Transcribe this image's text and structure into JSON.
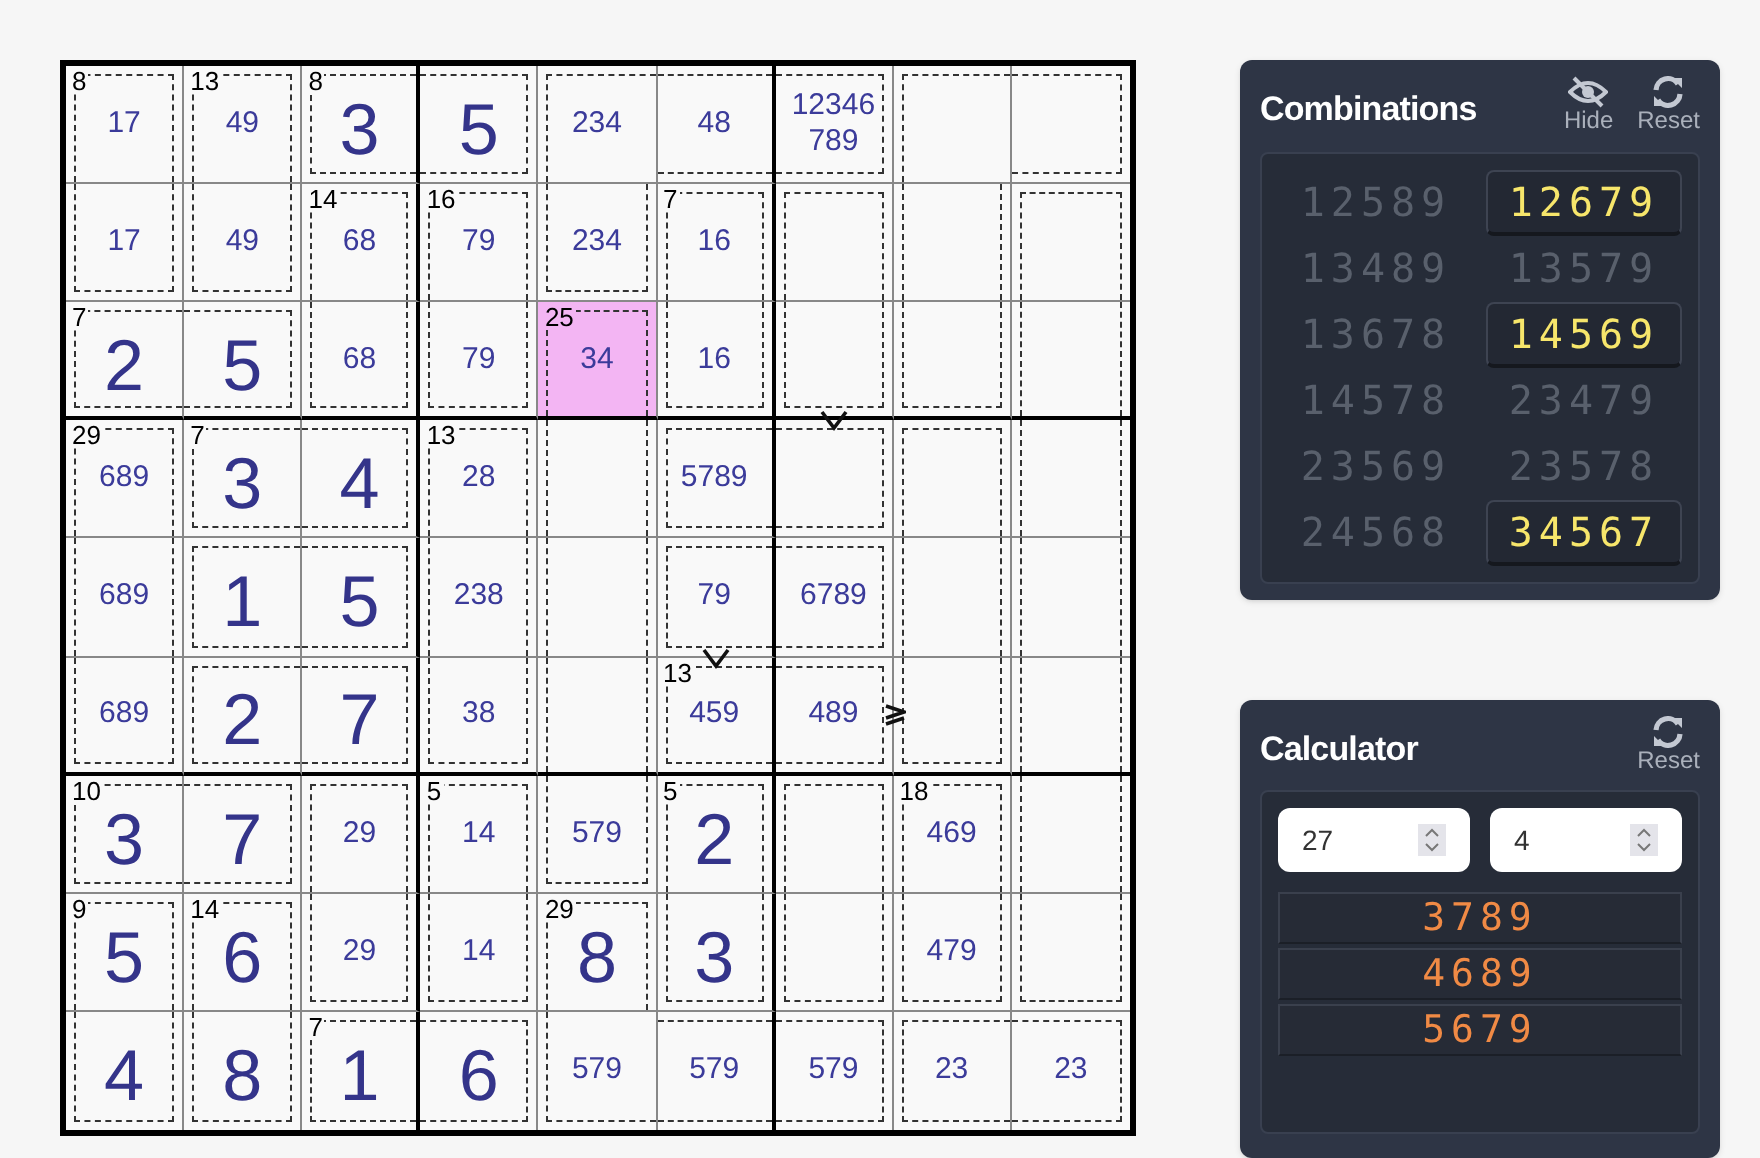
{
  "puzzle": {
    "rows": [
      [
        {
          "candidates": "17",
          "cage_sum": "8",
          "cage_top": true,
          "cage_right": true,
          "cage_bottom": false,
          "cage_left": true,
          "selected": false
        },
        {
          "candidates": "49",
          "cage_sum": "13",
          "cage_top": true,
          "cage_right": true,
          "cage_bottom": false,
          "cage_left": true,
          "selected": false
        },
        {
          "value": "3",
          "cage_sum": "8",
          "cage_top": true,
          "cage_right": false,
          "cage_bottom": true,
          "cage_left": true,
          "selected": false
        },
        {
          "value": "5",
          "cage_top": true,
          "cage_right": true,
          "cage_bottom": true,
          "cage_left": false,
          "selected": false
        },
        {
          "candidates": "234",
          "cage_top": true,
          "cage_right": false,
          "cage_bottom": false,
          "cage_left": true,
          "selected": false
        },
        {
          "candidates": "48",
          "cage_top": true,
          "cage_right": false,
          "cage_bottom": true,
          "cage_left": false,
          "selected": false
        },
        {
          "candidates": "12346789",
          "cage_top": true,
          "cage_right": true,
          "cage_bottom": true,
          "cage_left": false,
          "selected": false
        },
        {
          "cage_top": true,
          "cage_right": false,
          "cage_bottom": false,
          "cage_left": true,
          "selected": false
        },
        {
          "cage_top": true,
          "cage_right": true,
          "cage_bottom": true,
          "cage_left": false,
          "selected": false
        }
      ],
      [
        {
          "candidates": "17",
          "cage_top": false,
          "cage_right": true,
          "cage_bottom": true,
          "cage_left": true,
          "selected": false
        },
        {
          "candidates": "49",
          "cage_top": false,
          "cage_right": true,
          "cage_bottom": true,
          "cage_left": true,
          "selected": false
        },
        {
          "candidates": "68",
          "cage_sum": "14",
          "cage_top": true,
          "cage_right": true,
          "cage_bottom": false,
          "cage_left": true,
          "selected": false
        },
        {
          "candidates": "79",
          "cage_sum": "16",
          "cage_top": true,
          "cage_right": true,
          "cage_bottom": false,
          "cage_left": true,
          "selected": false
        },
        {
          "candidates": "234",
          "cage_top": false,
          "cage_right": true,
          "cage_bottom": true,
          "cage_left": true,
          "selected": false
        },
        {
          "candidates": "16",
          "cage_sum": "7",
          "cage_top": true,
          "cage_right": true,
          "cage_bottom": false,
          "cage_left": true,
          "selected": false
        },
        {
          "cage_top": true,
          "cage_right": true,
          "cage_bottom": false,
          "cage_left": true,
          "selected": false
        },
        {
          "cage_top": false,
          "cage_right": true,
          "cage_bottom": false,
          "cage_left": true,
          "selected": false
        },
        {
          "cage_top": true,
          "cage_right": true,
          "cage_bottom": false,
          "cage_left": true,
          "selected": false
        }
      ],
      [
        {
          "value": "2",
          "cage_sum": "7",
          "cage_top": true,
          "cage_right": false,
          "cage_bottom": true,
          "cage_left": true,
          "selected": false
        },
        {
          "value": "5",
          "cage_top": true,
          "cage_right": true,
          "cage_bottom": true,
          "cage_left": false,
          "selected": false
        },
        {
          "candidates": "68",
          "cage_top": false,
          "cage_right": true,
          "cage_bottom": true,
          "cage_left": true,
          "selected": false
        },
        {
          "candidates": "79",
          "cage_top": false,
          "cage_right": true,
          "cage_bottom": true,
          "cage_left": true,
          "selected": false
        },
        {
          "candidates": "34",
          "cage_sum": "25",
          "cage_top": true,
          "cage_right": true,
          "cage_bottom": false,
          "cage_left": true,
          "selected": true
        },
        {
          "candidates": "16",
          "cage_top": false,
          "cage_right": true,
          "cage_bottom": true,
          "cage_left": true,
          "selected": false
        },
        {
          "cage_top": false,
          "cage_right": true,
          "cage_bottom": true,
          "cage_left": true,
          "selected": false
        },
        {
          "cage_top": false,
          "cage_right": true,
          "cage_bottom": true,
          "cage_left": true,
          "selected": false
        },
        {
          "cage_top": false,
          "cage_right": true,
          "cage_bottom": false,
          "cage_left": true,
          "selected": false
        }
      ],
      [
        {
          "candidates": "689",
          "cage_sum": "29",
          "cage_top": true,
          "cage_right": true,
          "cage_bottom": false,
          "cage_left": true,
          "selected": false
        },
        {
          "value": "3",
          "cage_sum": "7",
          "cage_top": true,
          "cage_right": false,
          "cage_bottom": true,
          "cage_left": true,
          "selected": false
        },
        {
          "value": "4",
          "cage_top": true,
          "cage_right": true,
          "cage_bottom": true,
          "cage_left": false,
          "selected": false
        },
        {
          "candidates": "28",
          "cage_sum": "13",
          "cage_top": true,
          "cage_right": true,
          "cage_bottom": false,
          "cage_left": true,
          "selected": false
        },
        {
          "cage_top": false,
          "cage_right": true,
          "cage_bottom": false,
          "cage_left": true,
          "selected": false
        },
        {
          "candidates": "5789",
          "cage_top": true,
          "cage_right": false,
          "cage_bottom": true,
          "cage_left": true,
          "selected": false
        },
        {
          "cage_top": true,
          "cage_right": true,
          "cage_bottom": true,
          "cage_left": false,
          "inequality": {
            "kind": "greater-top"
          },
          "selected": false
        },
        {
          "cage_top": true,
          "cage_right": true,
          "cage_bottom": false,
          "cage_left": true,
          "selected": false
        },
        {
          "cage_top": false,
          "cage_right": true,
          "cage_bottom": false,
          "cage_left": true,
          "selected": false
        }
      ],
      [
        {
          "candidates": "689",
          "cage_top": false,
          "cage_right": true,
          "cage_bottom": false,
          "cage_left": true,
          "selected": false
        },
        {
          "value": "1",
          "cage_top": true,
          "cage_right": false,
          "cage_bottom": true,
          "cage_left": true,
          "selected": false
        },
        {
          "value": "5",
          "cage_top": true,
          "cage_right": true,
          "cage_bottom": true,
          "cage_left": false,
          "selected": false
        },
        {
          "candidates": "238",
          "cage_top": false,
          "cage_right": true,
          "cage_bottom": false,
          "cage_left": true,
          "selected": false
        },
        {
          "cage_top": false,
          "cage_right": true,
          "cage_bottom": false,
          "cage_left": true,
          "selected": false
        },
        {
          "candidates": "79",
          "cage_top": true,
          "cage_right": false,
          "cage_bottom": true,
          "cage_left": true,
          "selected": false
        },
        {
          "candidates": "6789",
          "cage_top": true,
          "cage_right": true,
          "cage_bottom": true,
          "cage_left": false,
          "selected": false
        },
        {
          "cage_top": false,
          "cage_right": true,
          "cage_bottom": false,
          "cage_left": true,
          "selected": false
        },
        {
          "cage_top": false,
          "cage_right": true,
          "cage_bottom": false,
          "cage_left": true,
          "selected": false
        }
      ],
      [
        {
          "candidates": "689",
          "cage_top": false,
          "cage_right": true,
          "cage_bottom": true,
          "cage_left": true,
          "selected": false
        },
        {
          "value": "2",
          "cage_top": true,
          "cage_right": false,
          "cage_bottom": true,
          "cage_left": true,
          "selected": false
        },
        {
          "value": "7",
          "cage_top": true,
          "cage_right": true,
          "cage_bottom": true,
          "cage_left": false,
          "selected": false
        },
        {
          "candidates": "38",
          "cage_top": false,
          "cage_right": true,
          "cage_bottom": true,
          "cage_left": true,
          "selected": false
        },
        {
          "cage_top": false,
          "cage_right": true,
          "cage_bottom": false,
          "cage_left": true,
          "selected": false
        },
        {
          "candidates": "459",
          "cage_sum": "13",
          "cage_top": true,
          "cage_right": false,
          "cage_bottom": true,
          "cage_left": true,
          "inequality": {
            "kind": "greater-top"
          },
          "selected": false
        },
        {
          "candidates": "489",
          "cage_top": true,
          "cage_right": true,
          "cage_bottom": true,
          "cage_left": false,
          "inequality": {
            "kind": "greater-or-equal-right"
          },
          "selected": false
        },
        {
          "cage_top": false,
          "cage_right": true,
          "cage_bottom": true,
          "cage_left": true,
          "selected": false
        },
        {
          "cage_top": false,
          "cage_right": true,
          "cage_bottom": false,
          "cage_left": true,
          "selected": false
        }
      ],
      [
        {
          "value": "3",
          "cage_sum": "10",
          "cage_top": true,
          "cage_right": false,
          "cage_bottom": true,
          "cage_left": true,
          "selected": false
        },
        {
          "value": "7",
          "cage_top": true,
          "cage_right": true,
          "cage_bottom": true,
          "cage_left": false,
          "selected": false
        },
        {
          "candidates": "29",
          "cage_top": true,
          "cage_right": true,
          "cage_bottom": false,
          "cage_left": true,
          "selected": false
        },
        {
          "candidates": "14",
          "cage_sum": "5",
          "cage_top": true,
          "cage_right": true,
          "cage_bottom": false,
          "cage_left": true,
          "selected": false
        },
        {
          "candidates": "579",
          "cage_top": false,
          "cage_right": true,
          "cage_bottom": true,
          "cage_left": true,
          "selected": false
        },
        {
          "value": "2",
          "cage_sum": "5",
          "cage_top": true,
          "cage_right": true,
          "cage_bottom": false,
          "cage_left": true,
          "selected": false
        },
        {
          "cage_top": true,
          "cage_right": true,
          "cage_bottom": false,
          "cage_left": true,
          "selected": false
        },
        {
          "candidates": "469",
          "cage_sum": "18",
          "cage_top": true,
          "cage_right": true,
          "cage_bottom": false,
          "cage_left": true,
          "selected": false
        },
        {
          "cage_top": false,
          "cage_right": true,
          "cage_bottom": false,
          "cage_left": true,
          "selected": false
        }
      ],
      [
        {
          "value": "5",
          "cage_sum": "9",
          "cage_top": true,
          "cage_right": true,
          "cage_bottom": false,
          "cage_left": true,
          "selected": false
        },
        {
          "value": "6",
          "cage_sum": "14",
          "cage_top": true,
          "cage_right": true,
          "cage_bottom": false,
          "cage_left": true,
          "selected": false
        },
        {
          "candidates": "29",
          "cage_top": false,
          "cage_right": true,
          "cage_bottom": true,
          "cage_left": true,
          "selected": false
        },
        {
          "candidates": "14",
          "cage_top": false,
          "cage_right": true,
          "cage_bottom": true,
          "cage_left": true,
          "selected": false
        },
        {
          "value": "8",
          "cage_sum": "29",
          "cage_top": true,
          "cage_right": true,
          "cage_bottom": false,
          "cage_left": true,
          "selected": false
        },
        {
          "value": "3",
          "cage_top": false,
          "cage_right": true,
          "cage_bottom": true,
          "cage_left": true,
          "selected": false
        },
        {
          "cage_top": false,
          "cage_right": true,
          "cage_bottom": true,
          "cage_left": true,
          "selected": false
        },
        {
          "candidates": "479",
          "cage_top": false,
          "cage_right": true,
          "cage_bottom": true,
          "cage_left": true,
          "selected": false
        },
        {
          "cage_top": false,
          "cage_right": true,
          "cage_bottom": true,
          "cage_left": true,
          "selected": false
        }
      ],
      [
        {
          "value": "4",
          "cage_top": false,
          "cage_right": true,
          "cage_bottom": true,
          "cage_left": true,
          "selected": false
        },
        {
          "value": "8",
          "cage_top": false,
          "cage_right": true,
          "cage_bottom": true,
          "cage_left": true,
          "selected": false
        },
        {
          "value": "1",
          "cage_sum": "7",
          "cage_top": true,
          "cage_right": false,
          "cage_bottom": true,
          "cage_left": true,
          "selected": false
        },
        {
          "value": "6",
          "cage_top": true,
          "cage_right": true,
          "cage_bottom": true,
          "cage_left": false,
          "selected": false
        },
        {
          "candidates": "579",
          "cage_top": false,
          "cage_right": false,
          "cage_bottom": true,
          "cage_left": true,
          "selected": false
        },
        {
          "candidates": "579",
          "cage_top": true,
          "cage_right": false,
          "cage_bottom": true,
          "cage_left": false,
          "selected": false
        },
        {
          "candidates": "579",
          "cage_top": true,
          "cage_right": true,
          "cage_bottom": true,
          "cage_left": false,
          "selected": false
        },
        {
          "candidates": "23",
          "cage_top": true,
          "cage_right": false,
          "cage_bottom": true,
          "cage_left": true,
          "selected": false
        },
        {
          "candidates": "23",
          "cage_top": true,
          "cage_right": true,
          "cage_bottom": true,
          "cage_left": false,
          "selected": false
        }
      ]
    ]
  },
  "combinations": {
    "title": "Combinations",
    "actions": [
      {
        "kind": "hide",
        "label": "Hide"
      },
      {
        "kind": "reset",
        "label": "Reset"
      }
    ],
    "items": [
      {
        "text": "12589",
        "selected": false
      },
      {
        "text": "12679",
        "selected": true
      },
      {
        "text": "13489",
        "selected": false
      },
      {
        "text": "13579",
        "selected": false
      },
      {
        "text": "13678",
        "selected": false
      },
      {
        "text": "14569",
        "selected": true
      },
      {
        "text": "14578",
        "selected": false
      },
      {
        "text": "23479",
        "selected": false
      },
      {
        "text": "23569",
        "selected": false
      },
      {
        "text": "23578",
        "selected": false
      },
      {
        "text": "24568",
        "selected": false
      },
      {
        "text": "34567",
        "selected": true
      }
    ]
  },
  "calculator": {
    "title": "Calculator",
    "actions": [
      {
        "kind": "reset",
        "label": "Reset"
      }
    ],
    "inputs": [
      {
        "value": "27"
      },
      {
        "value": "4"
      }
    ],
    "results": [
      "3789",
      "4689",
      "5679"
    ]
  }
}
